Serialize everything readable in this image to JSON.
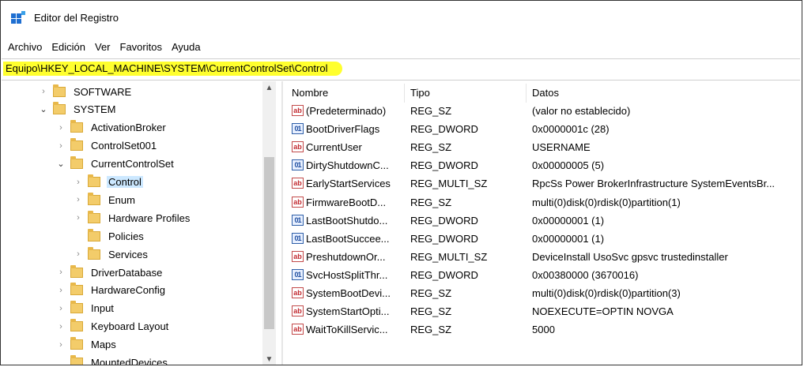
{
  "window": {
    "title": "Editor del Registro"
  },
  "menu": [
    "Archivo",
    "Edición",
    "Ver",
    "Favoritos",
    "Ayuda"
  ],
  "address": "Equipo\\HKEY_LOCAL_MACHINE\\SYSTEM\\CurrentControlSet\\Control",
  "tree": [
    {
      "label": "SOFTWARE",
      "level": 0,
      "expander": "collapsed"
    },
    {
      "label": "SYSTEM",
      "level": 0,
      "expander": "expanded"
    },
    {
      "label": "ActivationBroker",
      "level": 1,
      "expander": "collapsed"
    },
    {
      "label": "ControlSet001",
      "level": 1,
      "expander": "collapsed"
    },
    {
      "label": "CurrentControlSet",
      "level": 1,
      "expander": "expanded"
    },
    {
      "label": "Control",
      "level": 2,
      "expander": "collapsed",
      "selected": true
    },
    {
      "label": "Enum",
      "level": 2,
      "expander": "collapsed"
    },
    {
      "label": "Hardware Profiles",
      "level": 2,
      "expander": "collapsed"
    },
    {
      "label": "Policies",
      "level": 2,
      "expander": "none"
    },
    {
      "label": "Services",
      "level": 2,
      "expander": "collapsed"
    },
    {
      "label": "DriverDatabase",
      "level": 1,
      "expander": "collapsed"
    },
    {
      "label": "HardwareConfig",
      "level": 1,
      "expander": "collapsed"
    },
    {
      "label": "Input",
      "level": 1,
      "expander": "collapsed"
    },
    {
      "label": "Keyboard Layout",
      "level": 1,
      "expander": "collapsed"
    },
    {
      "label": "Maps",
      "level": 1,
      "expander": "collapsed"
    },
    {
      "label": "MountedDevices",
      "level": 1,
      "expander": "none"
    }
  ],
  "columns": {
    "name": "Nombre",
    "type": "Tipo",
    "data": "Datos"
  },
  "values": [
    {
      "icon": "sz",
      "name": "(Predeterminado)",
      "type": "REG_SZ",
      "data": "(valor no establecido)"
    },
    {
      "icon": "binary",
      "name": "BootDriverFlags",
      "type": "REG_DWORD",
      "data": "0x0000001c (28)"
    },
    {
      "icon": "sz",
      "name": "CurrentUser",
      "type": "REG_SZ",
      "data": "USERNAME"
    },
    {
      "icon": "binary",
      "name": "DirtyShutdownC...",
      "type": "REG_DWORD",
      "data": "0x00000005 (5)"
    },
    {
      "icon": "sz",
      "name": "EarlyStartServices",
      "type": "REG_MULTI_SZ",
      "data": "RpcSs Power BrokerInfrastructure SystemEventsBr..."
    },
    {
      "icon": "sz",
      "name": "FirmwareBootD...",
      "type": "REG_SZ",
      "data": "multi(0)disk(0)rdisk(0)partition(1)"
    },
    {
      "icon": "binary",
      "name": "LastBootShutdo...",
      "type": "REG_DWORD",
      "data": "0x00000001 (1)"
    },
    {
      "icon": "binary",
      "name": "LastBootSuccee...",
      "type": "REG_DWORD",
      "data": "0x00000001 (1)"
    },
    {
      "icon": "sz",
      "name": "PreshutdownOr...",
      "type": "REG_MULTI_SZ",
      "data": "DeviceInstall UsoSvc gpsvc trustedinstaller"
    },
    {
      "icon": "binary",
      "name": "SvcHostSplitThr...",
      "type": "REG_DWORD",
      "data": "0x00380000 (3670016)"
    },
    {
      "icon": "sz",
      "name": "SystemBootDevi...",
      "type": "REG_SZ",
      "data": "multi(0)disk(0)rdisk(0)partition(3)"
    },
    {
      "icon": "sz",
      "name": "SystemStartOpti...",
      "type": "REG_SZ",
      "data": " NOEXECUTE=OPTIN  NOVGA"
    },
    {
      "icon": "sz",
      "name": "WaitToKillServic...",
      "type": "REG_SZ",
      "data": "5000"
    }
  ],
  "colors": {
    "address_highlight": "#ffff2e",
    "selection": "#cce8ff"
  }
}
